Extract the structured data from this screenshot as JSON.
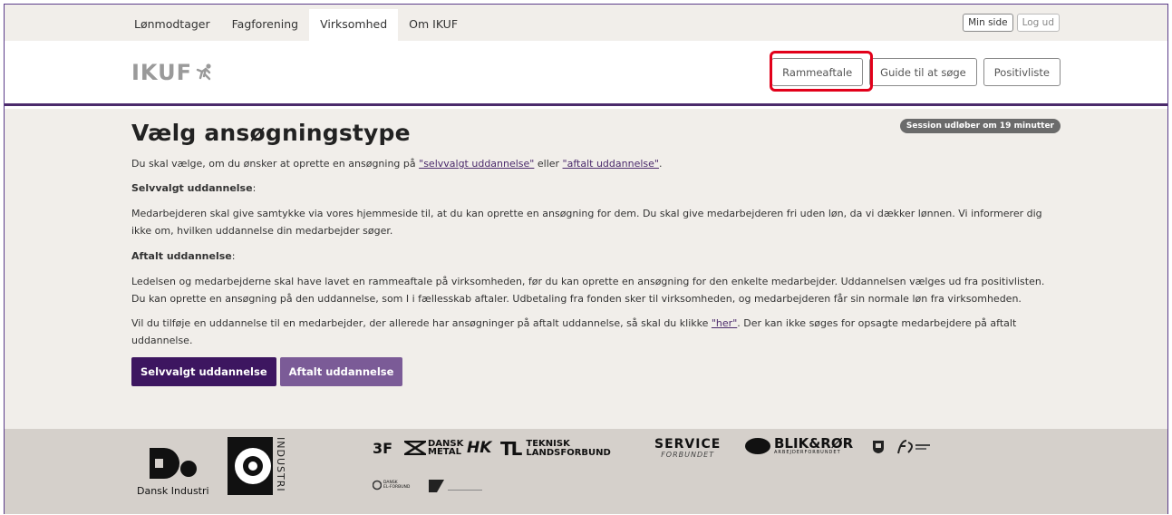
{
  "nav": {
    "tabs": [
      {
        "label": "Lønmodtager",
        "active": false
      },
      {
        "label": "Fagforening",
        "active": false
      },
      {
        "label": "Virksomhed",
        "active": true
      },
      {
        "label": "Om IKUF",
        "active": false
      }
    ],
    "account": {
      "my_page": "Min side",
      "logout": "Log ud"
    }
  },
  "header": {
    "logo_text": "IKUF",
    "buttons": {
      "framework": "Rammeaftale",
      "guide": "Guide til at søge",
      "positive_list": "Positivliste"
    }
  },
  "session_badge": "Session udløber om 19 minutter",
  "main": {
    "title": "Vælg ansøgningstype",
    "intro_before": "Du skal vælge, om du ønsker at oprette en ansøgning på ",
    "intro_link1": "\"selvvalgt uddannelse\"",
    "intro_mid": " eller ",
    "intro_link2": "\"aftalt uddannelse\"",
    "intro_after": ".",
    "self_heading": "Selvvalgt uddannelse",
    "self_heading_colon": ":",
    "self_text": "Medarbejderen skal give samtykke via vores hjemmeside til, at du kan oprette en ansøgning for dem. Du skal give medarbejderen fri uden løn, da vi dækker lønnen. Vi informerer dig ikke om, hvilken uddannelse din medarbejder søger.",
    "agreed_heading": "Aftalt uddannelse",
    "agreed_heading_colon": ":",
    "agreed_text": "Ledelsen og medarbejderne skal have lavet en rammeaftale på virksomheden, før du kan oprette en ansøgning for den enkelte medarbejder. Uddannelsen vælges ud fra positivlisten. Du kan oprette en ansøgning på den uddannelse, som I i fællesskab aftaler. Udbetaling fra fonden sker til virksomheden, og medarbejderen får sin normale løn fra virksomheden.",
    "add_before": "Vil du tilføje en uddannelse til en medarbejder, der allerede har ansøgninger på aftalt uddannelse, så skal du klikke ",
    "add_link": "\"her\"",
    "add_after": ". Der kan ikke søges for opsagte medarbejdere på aftalt uddannelse.",
    "buttons": {
      "self": "Selvvalgt uddannelse",
      "agreed": "Aftalt uddannelse"
    }
  },
  "footer": {
    "di_name": "Dansk Industri",
    "co_text": "INDUSTRI",
    "logos": [
      "3F",
      "DANSK",
      "METAL",
      "HK",
      "TL",
      "TEKNISK",
      "LANDSFORBUND",
      "SERVICE",
      "FORBUNDET",
      "BLIK&RØR",
      "ARBEJDERFORBUNDET",
      "DANSK",
      "EL-FORBUND"
    ]
  },
  "colors": {
    "primary": "#3d1660",
    "secondary": "#7b5b97",
    "highlight": "#e2001a",
    "page_bg": "#f1eeea",
    "footer_bg": "#d5d0cb"
  }
}
